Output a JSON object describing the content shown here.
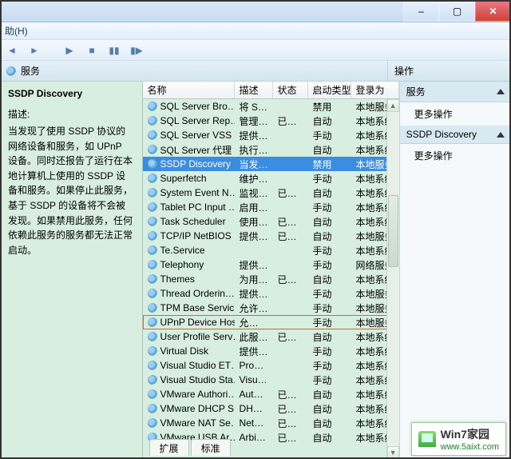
{
  "window": {
    "close_glyph": "✕"
  },
  "menu": {
    "help": "助(H)"
  },
  "sub_header": {
    "title": "服务"
  },
  "description": {
    "title": "SSDP Discovery",
    "label": "描述:",
    "body": "当发现了使用 SSDP 协议的网络设备和服务，如 UPnP 设备。同时还报告了运行在本地计算机上使用的 SSDP 设备和服务。如果停止此服务，基于 SSDP 的设备将不会被发现。如果禁用此服务，任何依赖此服务的服务都无法正常启动。"
  },
  "columns": {
    "name": "名称",
    "desc": "描述",
    "status": "状态",
    "startup": "启动类型",
    "logon": "登录为"
  },
  "services": [
    {
      "name": "SQL Server Bro…",
      "desc": "将 S…",
      "status": "",
      "startup": "禁用",
      "logon": "本地服务"
    },
    {
      "name": "SQL Server Rep…",
      "desc": "管理…",
      "status": "已启动",
      "startup": "自动",
      "logon": "本地系统"
    },
    {
      "name": "SQL Server VSS …",
      "desc": "提供…",
      "status": "",
      "startup": "手动",
      "logon": "本地系统"
    },
    {
      "name": "SQL Server 代理 …",
      "desc": "执行…",
      "status": "",
      "startup": "自动",
      "logon": "本地系统"
    },
    {
      "name": "SSDP Discovery",
      "desc": "当发…",
      "status": "",
      "startup": "禁用",
      "logon": "本地服务",
      "selected": true
    },
    {
      "name": "Superfetch",
      "desc": "维护…",
      "status": "",
      "startup": "手动",
      "logon": "本地系统"
    },
    {
      "name": "System Event N…",
      "desc": "监视…",
      "status": "已启动",
      "startup": "自动",
      "logon": "本地系统"
    },
    {
      "name": "Tablet PC Input …",
      "desc": "启用…",
      "status": "",
      "startup": "手动",
      "logon": "本地系统"
    },
    {
      "name": "Task Scheduler",
      "desc": "使用…",
      "status": "已启动",
      "startup": "自动",
      "logon": "本地系统"
    },
    {
      "name": "TCP/IP NetBIOS …",
      "desc": "提供…",
      "status": "已启动",
      "startup": "自动",
      "logon": "本地服务"
    },
    {
      "name": "Te.Service",
      "desc": "",
      "status": "",
      "startup": "手动",
      "logon": "本地系统"
    },
    {
      "name": "Telephony",
      "desc": "提供…",
      "status": "",
      "startup": "手动",
      "logon": "网络服务"
    },
    {
      "name": "Themes",
      "desc": "为用…",
      "status": "已启动",
      "startup": "自动",
      "logon": "本地系统"
    },
    {
      "name": "Thread Orderin…",
      "desc": "提供…",
      "status": "",
      "startup": "手动",
      "logon": "本地服务"
    },
    {
      "name": "TPM Base Servic…",
      "desc": "允许…",
      "status": "",
      "startup": "手动",
      "logon": "本地服务"
    },
    {
      "name": "UPnP Device Host",
      "desc": "允许 …",
      "status": "",
      "startup": "手动",
      "logon": "本地服务",
      "highlight": true
    },
    {
      "name": "User Profile Serv…",
      "desc": "此服…",
      "status": "已启动",
      "startup": "自动",
      "logon": "本地系统"
    },
    {
      "name": "Virtual Disk",
      "desc": "提供…",
      "status": "",
      "startup": "手动",
      "logon": "本地系统"
    },
    {
      "name": "Visual Studio ET…",
      "desc": "Prov…",
      "status": "",
      "startup": "手动",
      "logon": "本地系统"
    },
    {
      "name": "Visual Studio Sta…",
      "desc": "Visu…",
      "status": "",
      "startup": "手动",
      "logon": "本地系统"
    },
    {
      "name": "VMware Authori…",
      "desc": "Auth…",
      "status": "已启动",
      "startup": "自动",
      "logon": "本地系统"
    },
    {
      "name": "VMware DHCP S…",
      "desc": "DHC…",
      "status": "已启动",
      "startup": "自动",
      "logon": "本地系统"
    },
    {
      "name": "VMware NAT Se…",
      "desc": "Net…",
      "status": "已启动",
      "startup": "自动",
      "logon": "本地系统"
    },
    {
      "name": "VMware USB Ar…",
      "desc": "Arbit…",
      "status": "已启动",
      "startup": "自动",
      "logon": "本地系统"
    }
  ],
  "tabs": {
    "extended": "扩展",
    "standard": "标准"
  },
  "actions": {
    "header": "操作",
    "section1": "服务",
    "item1": "更多操作",
    "section2": "SSDP Discovery",
    "item2": "更多操作"
  },
  "watermark": {
    "title": "Win7家园",
    "url": "www.5aixt.com"
  }
}
